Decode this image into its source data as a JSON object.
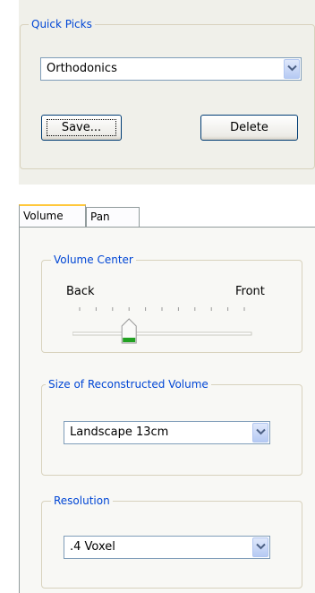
{
  "quick_picks": {
    "legend": "Quick Picks",
    "selected": "Orthodonics",
    "save_label": "Save...",
    "delete_label": "Delete"
  },
  "tabs": [
    {
      "label": "Volume",
      "active": true
    },
    {
      "label": "Pan",
      "active": false
    }
  ],
  "volume_center": {
    "legend": "Volume Center",
    "left_label": "Back",
    "right_label": "Front",
    "tick_count": 11,
    "slider_position_index": 3
  },
  "size": {
    "legend": "Size of Reconstructed Volume",
    "selected": "Landscape 13cm"
  },
  "resolution": {
    "legend": "Resolution",
    "selected": ".4 Voxel"
  },
  "icons": {
    "dropdown_arrow": "chevron-down-icon",
    "slider_thumb": "slider-thumb-icon"
  },
  "colors": {
    "legend": "#0046d5",
    "active_tab_accent": "#ffc83c",
    "slider_thumb_accent": "#21a121"
  }
}
